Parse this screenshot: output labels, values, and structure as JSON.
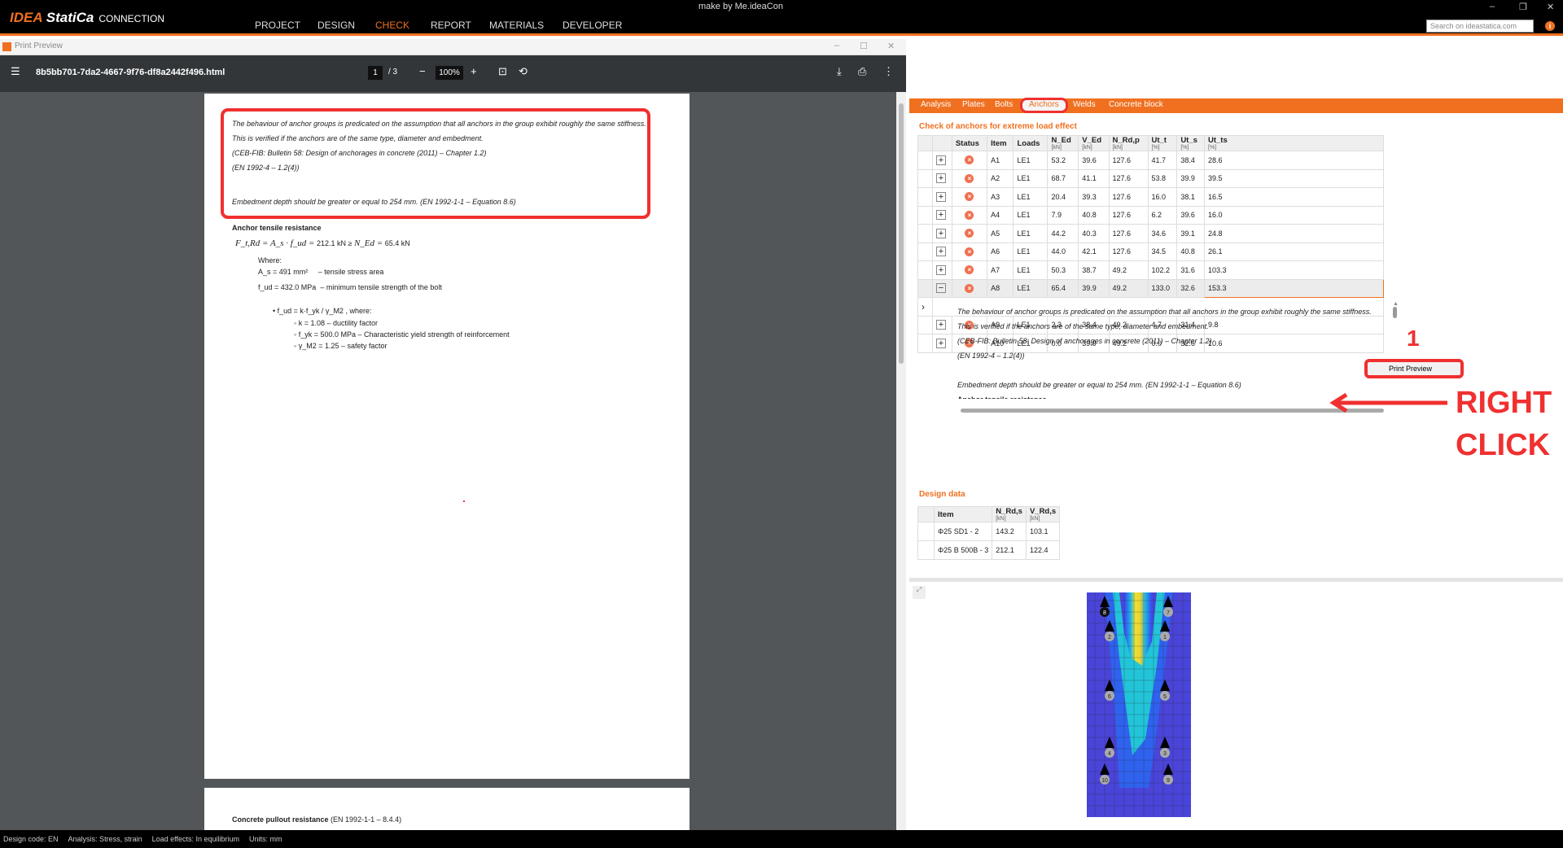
{
  "app": {
    "logo": "IDEA",
    "logo2": "StatiCa",
    "product": "CONNECTION",
    "window_title": "make by Me.ideaCon",
    "nav": [
      "PROJECT",
      "DESIGN",
      "CHECK",
      "REPORT",
      "MATERIALS",
      "DEVELOPER"
    ],
    "search_placeholder": "Search on ideastatica.com"
  },
  "print_preview": {
    "title": "Print Preview",
    "file": "8b5bb701-7da2-4667-9f76-df8a2442f496.html",
    "page": "1",
    "pages": "/ 3",
    "zoom": "100%"
  },
  "doc": {
    "lines": [
      "The behaviour of anchor groups is predicated on the assumption that all anchors in the group exhibit roughly the same stiffness.",
      "This is verified if the anchors are of the same type, diameter and embedment.",
      "(CEB-FIB: Bulletin 58: Design of anchorages in concrete (2011) – Chapter 1.2)",
      "(EN 1992-4 – 1.2(4))",
      "Embedment depth should be greater or equal to 254 mm. (EN 1992-1-1 – Equation 8.6)"
    ],
    "heading": "Anchor tensile resistance",
    "eq": "F_t,Rd = A_s · f_ud =",
    "eq_val": "212.1   kN   ≥",
    "eq_ned": "N_Ed =",
    "eq_ned_val": "65.4   kN",
    "where": "Where:",
    "as": "A_s = 491 mm²",
    "as_desc": "– tensile stress area",
    "fud": "f_ud = 432.0 MPa",
    "fud_desc": "– minimum tensile strength of the bolt",
    "fud_eq": "f_ud = k·f_yk / γ_M2 , where:",
    "k": "k = 1.08 – ductility factor",
    "fyk": "f_yk = 500.0 MPa – Characteristic yield strength of reinforcement",
    "gamma": "γ_M2 = 1.25 – safety factor",
    "page2_heading": "Concrete pullout resistance",
    "page2_ref": "(EN 1992-1-1 – 8.4.4)"
  },
  "tabs": [
    "Analysis",
    "Plates",
    "Bolts",
    "Anchors",
    "Welds",
    "Concrete block"
  ],
  "check_title": "Check of anchors for extreme load effect",
  "anchors": {
    "headers": [
      "Status",
      "Item",
      "Loads",
      "N_Ed",
      "V_Ed",
      "N_Rd,p",
      "Ut_t",
      "Ut_s",
      "Ut_ts"
    ],
    "units": [
      "",
      "",
      "",
      "[kN]",
      "[kN]",
      "[kN]",
      "[%]",
      "[%]",
      "[%]"
    ],
    "rows": [
      [
        "A1",
        "LE1",
        "53.2",
        "39.6",
        "127.6",
        "41.7",
        "38.4",
        "28.6"
      ],
      [
        "A2",
        "LE1",
        "68.7",
        "41.1",
        "127.6",
        "53.8",
        "39.9",
        "39.5"
      ],
      [
        "A3",
        "LE1",
        "20.4",
        "39.3",
        "127.6",
        "16.0",
        "38.1",
        "16.5"
      ],
      [
        "A4",
        "LE1",
        "7.9",
        "40.8",
        "127.6",
        "6.2",
        "39.6",
        "16.0"
      ],
      [
        "A5",
        "LE1",
        "44.2",
        "40.3",
        "127.6",
        "34.6",
        "39.1",
        "24.8"
      ],
      [
        "A6",
        "LE1",
        "44.0",
        "42.1",
        "127.6",
        "34.5",
        "40.8",
        "26.1"
      ],
      [
        "A7",
        "LE1",
        "50.3",
        "38.7",
        "49.2",
        "102.2",
        "31.6",
        "103.3"
      ],
      [
        "A8",
        "LE1",
        "65.4",
        "39.9",
        "49.2",
        "133.0",
        "32.6",
        "153.3"
      ]
    ],
    "rows_after": [
      [
        "A9",
        "LE1",
        "2.3",
        "38.4",
        "49.2",
        "4.7",
        "31.4",
        "9.8"
      ],
      [
        "A10",
        "LE1",
        "0.0",
        "39.9",
        "49.2",
        "0.0",
        "32.6",
        "10.6"
      ]
    ],
    "detail_cut": "Anchor tensile resistance"
  },
  "design_title": "Design data",
  "design": {
    "headers": [
      "Item",
      "N_Rd,s",
      "V_Rd,s"
    ],
    "units": [
      "",
      "[kN]",
      "[kN]"
    ],
    "rows": [
      [
        "Φ25 SD1 - 2",
        "143.2",
        "103.1"
      ],
      [
        "Φ25 B 500B - 3",
        "212.1",
        "122.4"
      ]
    ]
  },
  "anchor_labels": [
    "8",
    "7",
    "2",
    "1",
    "6",
    "5",
    "4",
    "3",
    "10",
    "9"
  ],
  "context_menu": {
    "item": "Print Preview"
  },
  "annotation": {
    "step": "1",
    "line1": "RIGHT",
    "line2": "CLICK"
  },
  "status": [
    "Design code: EN",
    "Analysis: Stress, strain",
    "Load effects: In equilibrium",
    "Units: mm"
  ]
}
